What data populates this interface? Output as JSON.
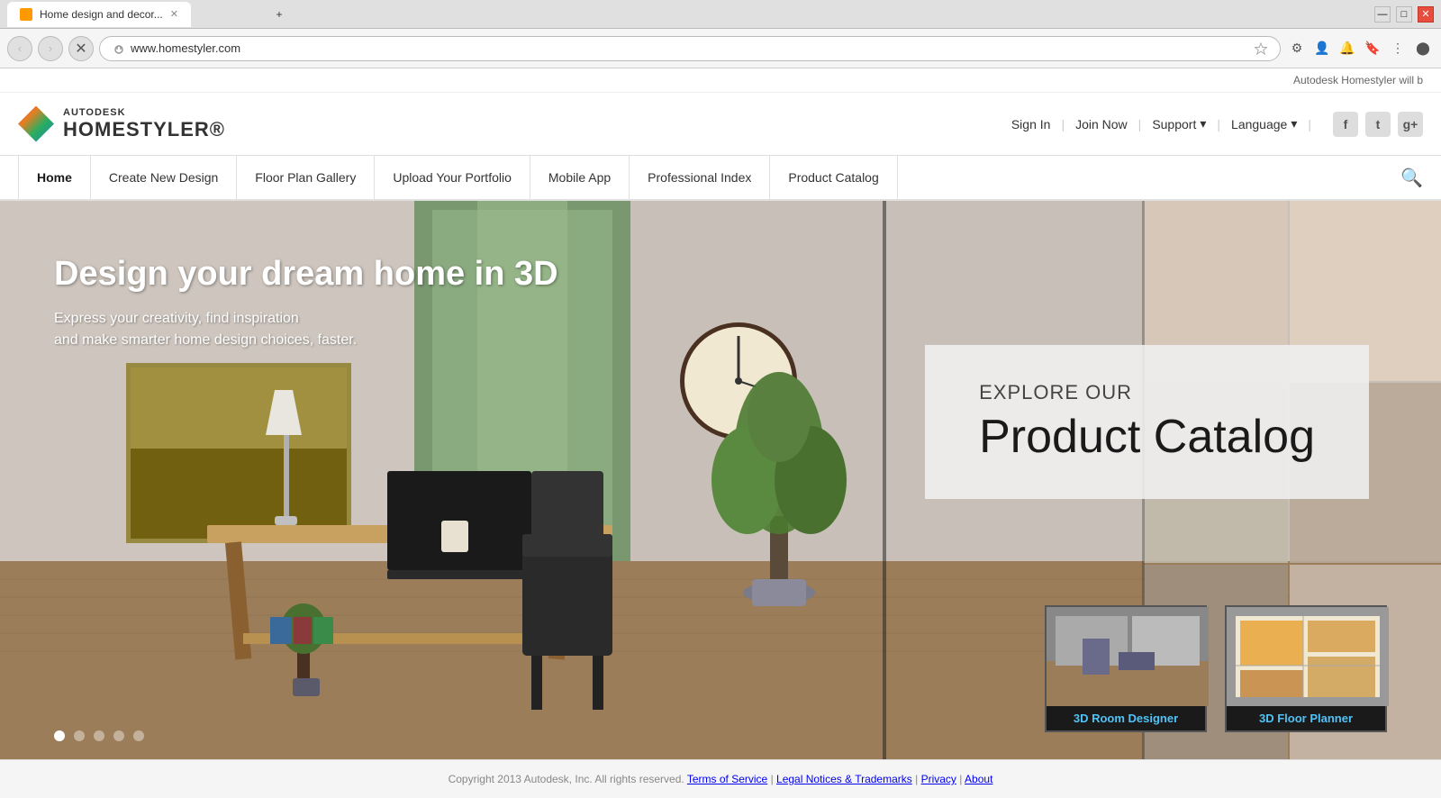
{
  "browser": {
    "tab_title": "Home design and decor...",
    "tab_new_label": "+",
    "url": "www.homestyler.com",
    "nav_back": "‹",
    "nav_forward": "›",
    "nav_reload": "✕"
  },
  "announcement": {
    "text": "Autodesk Homestyler will b"
  },
  "header": {
    "logo_autodesk": "AUTODESK",
    "logo_homestyler": "HOMESTYLER®",
    "sign_in": "Sign In",
    "join_now": "Join Now",
    "support": "Support",
    "language": "Language"
  },
  "nav": {
    "items": [
      {
        "label": "Home",
        "active": true
      },
      {
        "label": "Create New Design",
        "active": false
      },
      {
        "label": "Floor Plan Gallery",
        "active": false
      },
      {
        "label": "Upload Your Portfolio",
        "active": false
      },
      {
        "label": "Mobile App",
        "active": false
      },
      {
        "label": "Professional Index",
        "active": false
      },
      {
        "label": "Product Catalog",
        "active": false
      }
    ]
  },
  "hero": {
    "headline": "Design your dream home in 3D",
    "subtext_line1": "Express your creativity, find inspiration",
    "subtext_line2": "and make smarter home design choices, faster.",
    "explore_label": "EXPLORE OUR",
    "catalog_title_line1": "Product Catalog"
  },
  "thumbnails": [
    {
      "label": "3D Room Designer"
    },
    {
      "label": "3D Floor Planner"
    }
  ],
  "dots": [
    {
      "active": true
    },
    {
      "active": false
    },
    {
      "active": false
    },
    {
      "active": false
    },
    {
      "active": false
    }
  ],
  "footer": {
    "copyright": "Copyright 2013 Autodesk, Inc. All rights reserved.",
    "links": [
      "Terms of Service",
      "Legal Notices & Trademarks",
      "Privacy",
      "About"
    ]
  },
  "social": {
    "facebook": "f",
    "twitter": "t",
    "google_plus": "g+"
  }
}
